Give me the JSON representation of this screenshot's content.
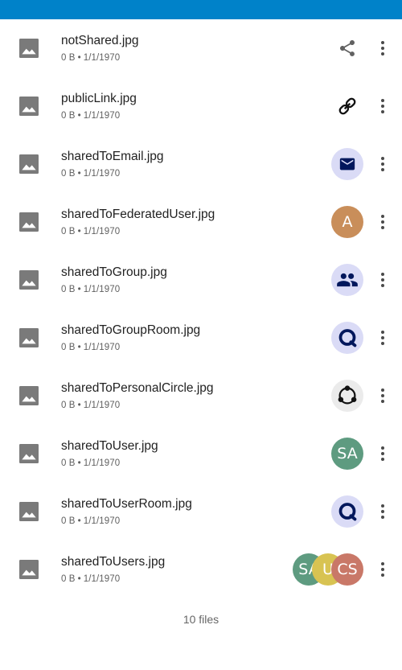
{
  "colors": {
    "primary": "#0082c9",
    "icon_grey": "#616161",
    "navy": "#00175c",
    "lavender": "#dadbf6"
  },
  "files": [
    {
      "name": "notShared.jpg",
      "size": "0 B",
      "date": "1/1/1970",
      "share_icon": "share-icon"
    },
    {
      "name": "publicLink.jpg",
      "size": "0 B",
      "date": "1/1/1970",
      "share_icon": "link-icon"
    },
    {
      "name": "sharedToEmail.jpg",
      "size": "0 B",
      "date": "1/1/1970",
      "share_icon": "email-icon"
    },
    {
      "name": "sharedToFederatedUser.jpg",
      "size": "0 B",
      "date": "1/1/1970",
      "share_icon": "avatar",
      "avatar": {
        "initials": "A",
        "color": "#c98e5a"
      }
    },
    {
      "name": "sharedToGroup.jpg",
      "size": "0 B",
      "date": "1/1/1970",
      "share_icon": "group-icon"
    },
    {
      "name": "sharedToGroupRoom.jpg",
      "size": "0 B",
      "date": "1/1/1970",
      "share_icon": "talk-room-icon"
    },
    {
      "name": "sharedToPersonalCircle.jpg",
      "size": "0 B",
      "date": "1/1/1970",
      "share_icon": "circles-icon"
    },
    {
      "name": "sharedToUser.jpg",
      "size": "0 B",
      "date": "1/1/1970",
      "share_icon": "avatar",
      "avatar": {
        "initials": "SA",
        "color": "#5e9b80"
      }
    },
    {
      "name": "sharedToUserRoom.jpg",
      "size": "0 B",
      "date": "1/1/1970",
      "share_icon": "talk-room-icon"
    },
    {
      "name": "sharedToUsers.jpg",
      "size": "0 B",
      "date": "1/1/1970",
      "share_icon": "avatar-stack",
      "avatars": [
        {
          "initials": "SA",
          "color": "#5e9b80"
        },
        {
          "initials": "U",
          "color": "#d8c352"
        },
        {
          "initials": "CS",
          "color": "#c97868"
        }
      ]
    }
  ],
  "meta_separator": "•",
  "footer": {
    "count_label": "10 files"
  }
}
